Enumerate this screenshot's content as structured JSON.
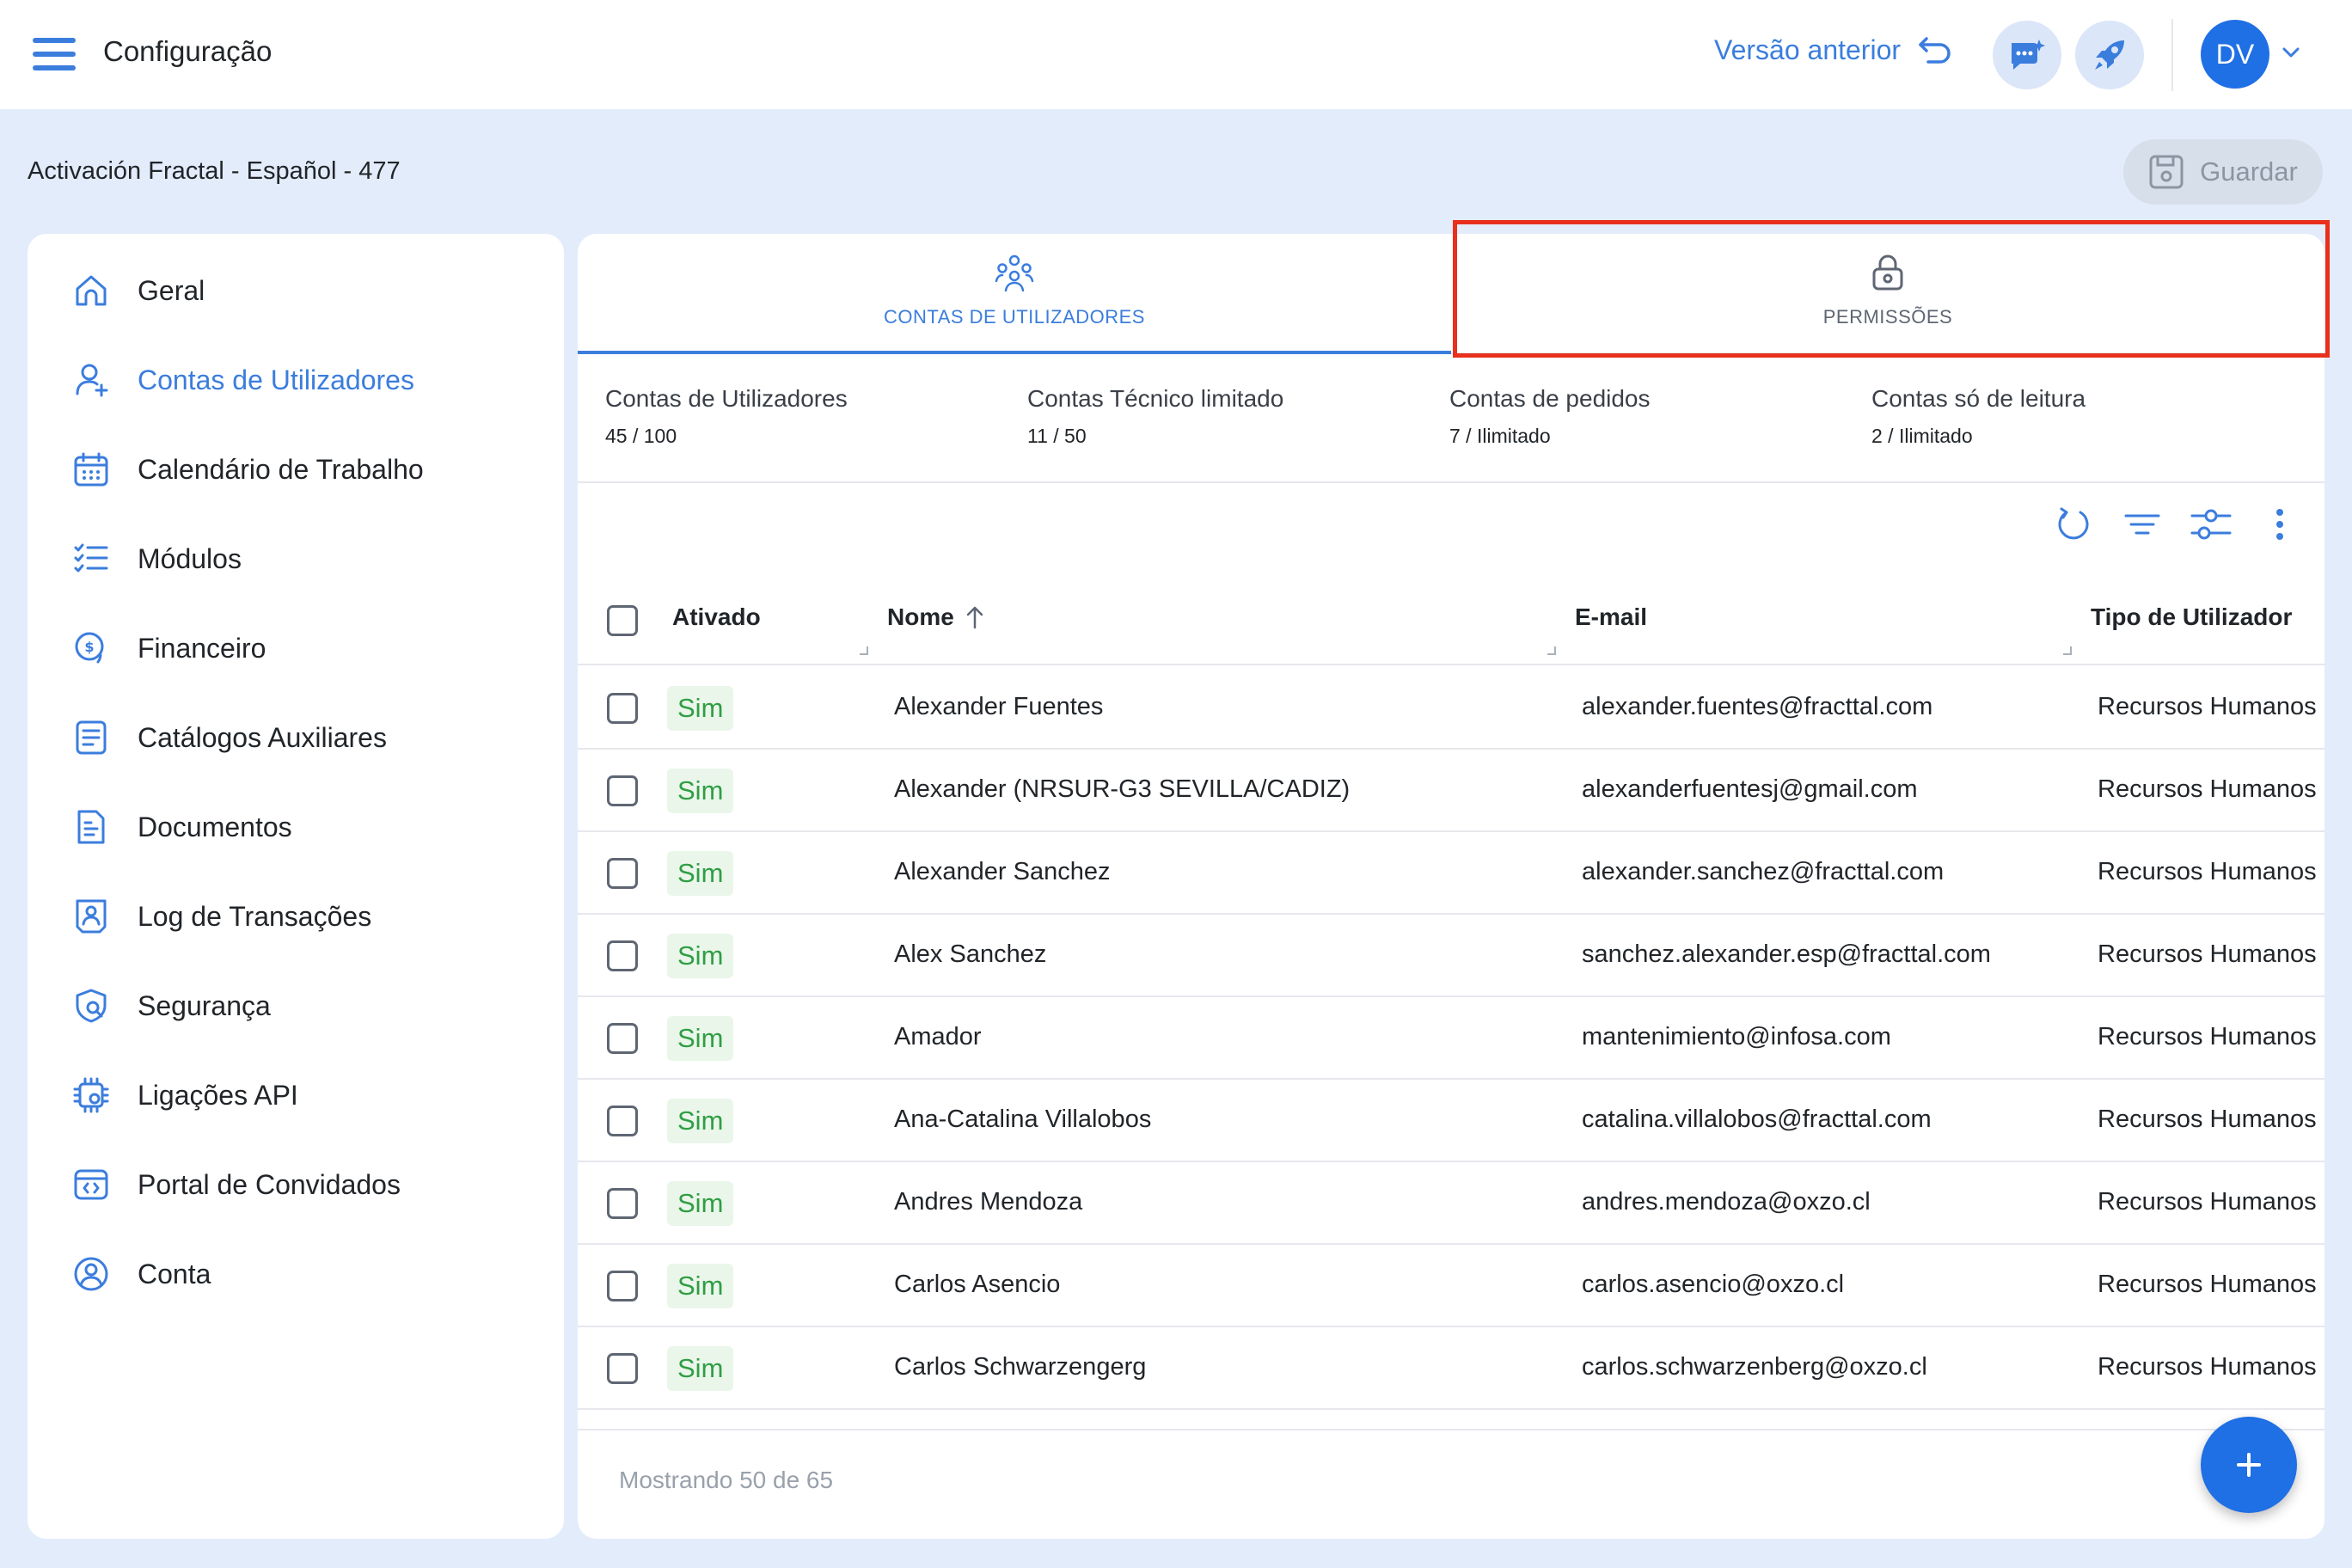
{
  "app": {
    "title": "Configuração"
  },
  "header": {
    "prev_version_label": "Versão anterior",
    "avatar_initials": "DV"
  },
  "breadcrumb": "Activación Fractal - Español - 477",
  "save_label": "Guardar",
  "sidebar": {
    "items": [
      {
        "label": "Geral",
        "icon": "home-icon"
      },
      {
        "label": "Contas de Utilizadores",
        "icon": "user-add-icon",
        "active": true
      },
      {
        "label": "Calendário de Trabalho",
        "icon": "calendar-icon"
      },
      {
        "label": "Módulos",
        "icon": "checklist-icon"
      },
      {
        "label": "Financeiro",
        "icon": "money-icon"
      },
      {
        "label": "Catálogos Auxiliares",
        "icon": "catalog-icon"
      },
      {
        "label": "Documentos",
        "icon": "document-icon"
      },
      {
        "label": "Log de Transações",
        "icon": "log-icon"
      },
      {
        "label": "Segurança",
        "icon": "security-icon"
      },
      {
        "label": "Ligações API",
        "icon": "api-icon"
      },
      {
        "label": "Portal de Convidados",
        "icon": "portal-icon"
      },
      {
        "label": "Conta",
        "icon": "account-icon"
      }
    ]
  },
  "tabs": [
    {
      "label": "CONTAS DE UTILIZADORES",
      "icon": "users-group-icon",
      "active": true
    },
    {
      "label": "PERMISSÕES",
      "icon": "lock-icon",
      "active": false
    }
  ],
  "stats": [
    {
      "label": "Contas de Utilizadores",
      "value": "45 / 100"
    },
    {
      "label": "Contas Técnico limitado",
      "value": "11 / 50"
    },
    {
      "label": "Contas de pedidos",
      "value": "7 / Ilimitado"
    },
    {
      "label": "Contas só de leitura",
      "value": "2 / Ilimitado"
    }
  ],
  "table": {
    "columns": [
      "Ativado",
      "Nome",
      "E-mail",
      "Tipo de Utilizador"
    ],
    "sort_column": "Nome",
    "rows": [
      {
        "active": "Sim",
        "name": "Alexander Fuentes",
        "email": "alexander.fuentes@fracttal.com",
        "type": "Recursos Humanos"
      },
      {
        "active": "Sim",
        "name": "Alexander (NRSUR-G3 SEVILLA/CADIZ)",
        "email": "alexanderfuentesj@gmail.com",
        "type": "Recursos Humanos"
      },
      {
        "active": "Sim",
        "name": "Alexander Sanchez",
        "email": "alexander.sanchez@fracttal.com",
        "type": "Recursos Humanos"
      },
      {
        "active": "Sim",
        "name": "Alex Sanchez",
        "email": "sanchez.alexander.esp@fracttal.com",
        "type": "Recursos Humanos"
      },
      {
        "active": "Sim",
        "name": "Amador",
        "email": "mantenimiento@infosa.com",
        "type": "Recursos Humanos"
      },
      {
        "active": "Sim",
        "name": "Ana-Catalina Villalobos",
        "email": "catalina.villalobos@fracttal.com",
        "type": "Recursos Humanos"
      },
      {
        "active": "Sim",
        "name": "Andres Mendoza",
        "email": "andres.mendoza@oxzo.cl",
        "type": "Recursos Humanos"
      },
      {
        "active": "Sim",
        "name": "Carlos Asencio",
        "email": "carlos.asencio@oxzo.cl",
        "type": "Recursos Humanos"
      },
      {
        "active": "Sim",
        "name": "Carlos Schwarzengerg",
        "email": "carlos.schwarzenberg@oxzo.cl",
        "type": "Recursos Humanos"
      }
    ]
  },
  "footer": {
    "showing_text": "Mostrando 50 de 65"
  },
  "colors": {
    "accent": "#1f6fe5",
    "link": "#3b7ddd",
    "success": "#2f9e44",
    "highlight": "#e8301c",
    "background": "#e3ecfb"
  }
}
